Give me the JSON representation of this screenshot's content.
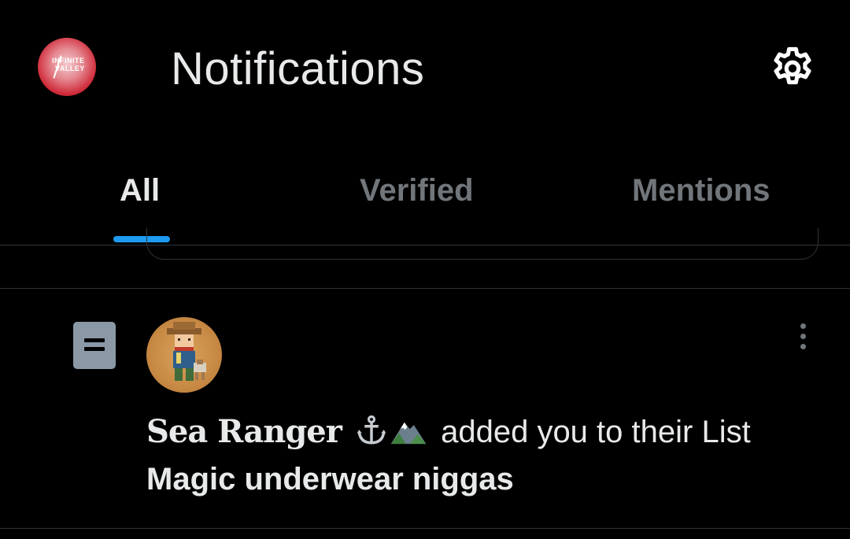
{
  "header": {
    "title": "Notifications",
    "avatar_logo_line1": "INFINITE",
    "avatar_logo_line2": "VALLEY"
  },
  "tabs": [
    {
      "label": "All",
      "active": true
    },
    {
      "label": "Verified",
      "active": false
    },
    {
      "label": "Mentions",
      "active": false
    }
  ],
  "notification": {
    "icon": "list-icon",
    "user_name": "Sea Ranger",
    "name_emojis": [
      "anchor-icon",
      "mountain-icon"
    ],
    "action": "added you to their List",
    "list_name": "Magic underwear niggas"
  },
  "colors": {
    "background": "#000000",
    "text_primary": "#e7e9ea",
    "text_secondary": "#71767b",
    "accent": "#1d9bf0",
    "divider": "#2f3336"
  }
}
